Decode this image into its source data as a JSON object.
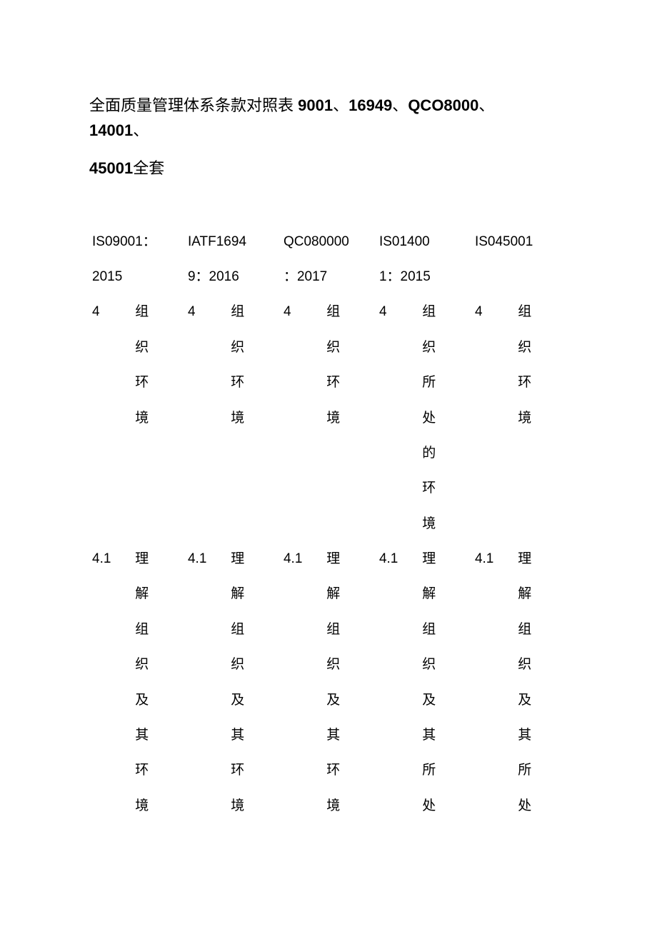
{
  "title": {
    "prefix": "全面质量管理体系条款对照表",
    "bold1": "9001",
    "sep1": "、",
    "bold2": "16949",
    "sep2": "、",
    "bold3": "QCO8000",
    "sep3": "、",
    "bold4": "14001",
    "sep4": "、"
  },
  "subtitle": {
    "bold": "45001",
    "rest": "全套"
  },
  "standards": [
    {
      "head1": "IS09001：",
      "head2": "2015"
    },
    {
      "head1": "IATF1694",
      "head2": "9：2016"
    },
    {
      "head1": "QC080000",
      "head2": "：2017"
    },
    {
      "head1": "IS01400",
      "head2": "1：2015"
    },
    {
      "head1": "IS045001",
      "head2": ""
    }
  ],
  "rows": [
    {
      "cells": [
        {
          "num": "4",
          "text": "组织环境"
        },
        {
          "num": "4",
          "text": "组织环境"
        },
        {
          "num": "4",
          "text": "组织环境"
        },
        {
          "num": "4",
          "text": "组织所处的环境"
        },
        {
          "num": "4",
          "text": "组织环境"
        }
      ]
    },
    {
      "cells": [
        {
          "num": "4.1",
          "text": "理解组织及其环境"
        },
        {
          "num": "4.1",
          "text": "理解组织及其环境"
        },
        {
          "num": "4.1",
          "text": "理解组织及其环境"
        },
        {
          "num": "4.1",
          "text": "理解组织及其所处"
        },
        {
          "num": "4.1",
          "text": "理解组织及其所处"
        }
      ]
    }
  ]
}
